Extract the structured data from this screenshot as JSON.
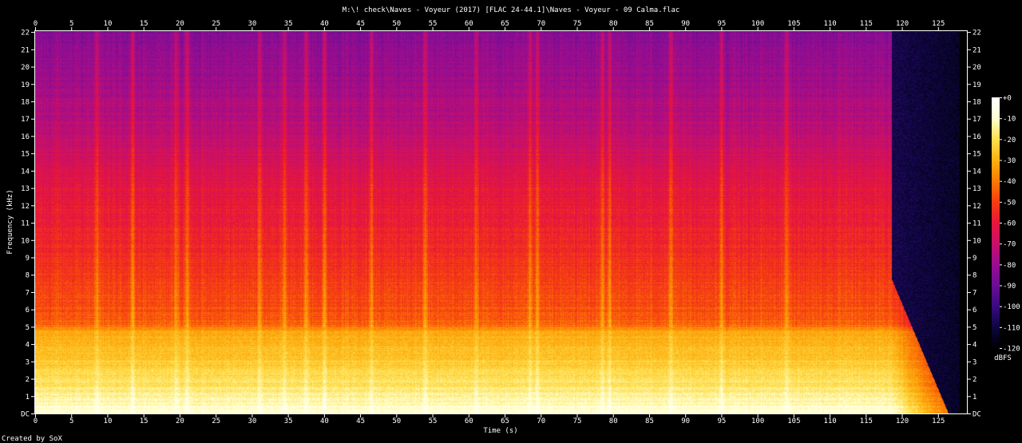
{
  "title": "M:\\! check\\Naves - Voyeur (2017) [FLAC 24-44.1]\\Naves - Voyeur - 09 Calma.flac",
  "footer": "Created by SoX",
  "chart_data": {
    "type": "heatmap",
    "title": "M:\\! check\\Naves - Voyeur (2017) [FLAC 24-44.1]\\Naves - Voyeur - 09 Calma.flac",
    "xlabel": "Time (s)",
    "ylabel": "Frequency (kHz)",
    "xlim": [
      0,
      129
    ],
    "ylim": [
      0,
      22.05
    ],
    "x_ticks": [
      0,
      5,
      10,
      15,
      20,
      25,
      30,
      35,
      40,
      45,
      50,
      55,
      60,
      65,
      70,
      75,
      80,
      85,
      90,
      95,
      100,
      105,
      110,
      115,
      120,
      125
    ],
    "y_ticks": [
      "DC",
      "1",
      "2",
      "3",
      "4",
      "5",
      "6",
      "7",
      "8",
      "9",
      "10",
      "11",
      "12",
      "13",
      "14",
      "15",
      "16",
      "17",
      "18",
      "19",
      "20",
      "21",
      "22"
    ],
    "colorbar": {
      "label": "dBFS",
      "range": [
        -120,
        0
      ],
      "ticks": [
        "+0",
        "-10",
        "-20",
        "-30",
        "-40",
        "-50",
        "-60",
        "-70",
        "-80",
        "-90",
        "-100",
        "-110",
        "-120"
      ],
      "stops": [
        "#000000",
        "#0d0640",
        "#3a0a80",
        "#6a0d95",
        "#9a0d90",
        "#c8106a",
        "#e8163a",
        "#f63e10",
        "#fb7a05",
        "#fdb010",
        "#fee050",
        "#ffffd0",
        "#ffffff"
      ]
    },
    "audio_end_s": 118.6,
    "fade_out_end_s": 128.0,
    "bands_db": [
      {
        "freq_khz": 0,
        "db": -8
      },
      {
        "freq_khz": 2,
        "db": -20
      },
      {
        "freq_khz": 4.8,
        "db": -32
      },
      {
        "freq_khz": 5.2,
        "db": -45
      },
      {
        "freq_khz": 9.5,
        "db": -55
      },
      {
        "freq_khz": 13,
        "db": -62
      },
      {
        "freq_khz": 17,
        "db": -74
      },
      {
        "freq_khz": 22,
        "db": -84
      }
    ],
    "transients_s": [
      8.5,
      13.5,
      19.5,
      21,
      31,
      34.5,
      37.5,
      40,
      46.5,
      54,
      61,
      68.5,
      69.5,
      78.5,
      79.5,
      88,
      95,
      104
    ]
  }
}
